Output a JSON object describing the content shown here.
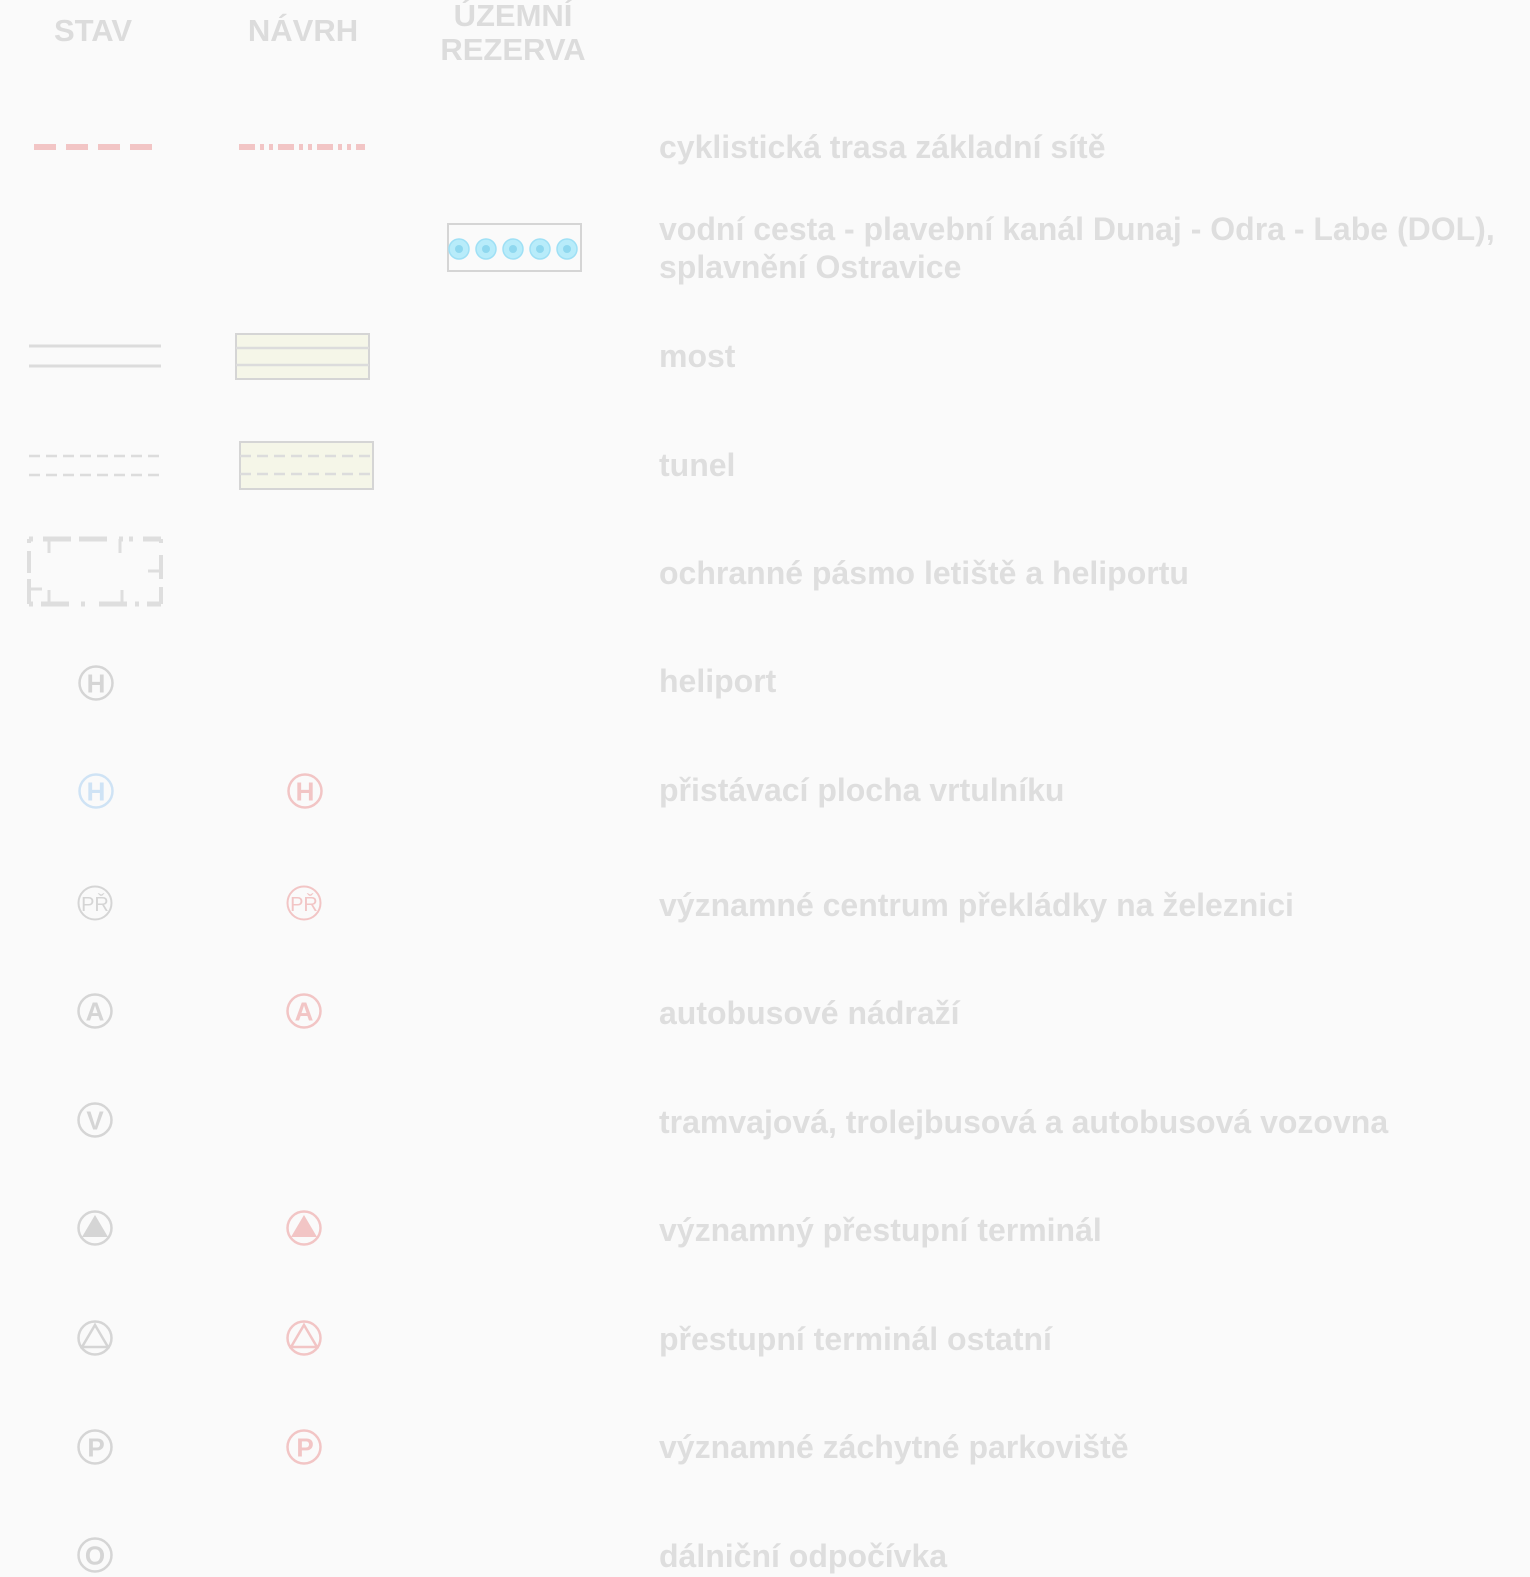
{
  "headers": {
    "stav": "STAV",
    "navrh": "NÁVRH",
    "rezerva_line1": "ÚZEMNÍ",
    "rezerva_line2": "REZERVA"
  },
  "colors": {
    "background": "#fafafa",
    "grey": "#d7d7d7",
    "pink": "#f2c5c5",
    "blue": "#cfe3f5",
    "cyan": "#aee8f8",
    "cream": "#f5f6e8"
  },
  "rows": [
    {
      "id": "cyklo",
      "label": "cyklistická trasa základní sítě",
      "stav": "dashed-pink-line",
      "navrh": "dash-dot-pink-line"
    },
    {
      "id": "vodni",
      "label_line1": "vodní cesta - plavební kanál Dunaj - Odra - Labe (DOL),",
      "label_line2": "splavnění Ostravice",
      "rezerva": "circles-box"
    },
    {
      "id": "most",
      "label": "most",
      "stav": "double-line",
      "navrh": "cream-box-double-line"
    },
    {
      "id": "tunel",
      "label": "tunel",
      "stav": "double-dashed-line",
      "navrh": "cream-box-dashed-line"
    },
    {
      "id": "ochranne",
      "label": "ochranné pásmo letiště a heliportu",
      "stav": "dashed-zone-box"
    },
    {
      "id": "heliport",
      "label": "heliport",
      "stav": "H",
      "stav_color": "grey"
    },
    {
      "id": "pristavaci",
      "label": "přistávací plocha vrtulníku",
      "stav": "H",
      "stav_color": "blue",
      "navrh": "H",
      "navrh_color": "pink"
    },
    {
      "id": "prekladka",
      "label": "významné centrum překládky na železnici",
      "stav": "PŘ",
      "stav_color": "grey",
      "navrh": "PŘ",
      "navrh_color": "pink"
    },
    {
      "id": "autobus",
      "label": "autobusové nádraží",
      "stav": "A",
      "stav_color": "grey",
      "navrh": "A",
      "navrh_color": "pink"
    },
    {
      "id": "vozovna",
      "label": "tramvajová, trolejbusová a autobusová vozovna",
      "stav": "V",
      "stav_color": "grey"
    },
    {
      "id": "terminal-vyz",
      "label": "významný přestupní terminál",
      "stav": "filled-triangle",
      "stav_color": "grey",
      "navrh": "filled-triangle",
      "navrh_color": "pink"
    },
    {
      "id": "terminal-ost",
      "label": "přestupní terminál ostatní",
      "stav": "outline-triangle",
      "stav_color": "grey",
      "navrh": "outline-triangle",
      "navrh_color": "pink"
    },
    {
      "id": "parkoviste",
      "label": "významné záchytné parkoviště",
      "stav": "P",
      "stav_color": "grey",
      "navrh": "P",
      "navrh_color": "pink"
    },
    {
      "id": "odpocivka",
      "label": "dálniční odpočívka",
      "stav": "O",
      "stav_color": "grey"
    }
  ]
}
